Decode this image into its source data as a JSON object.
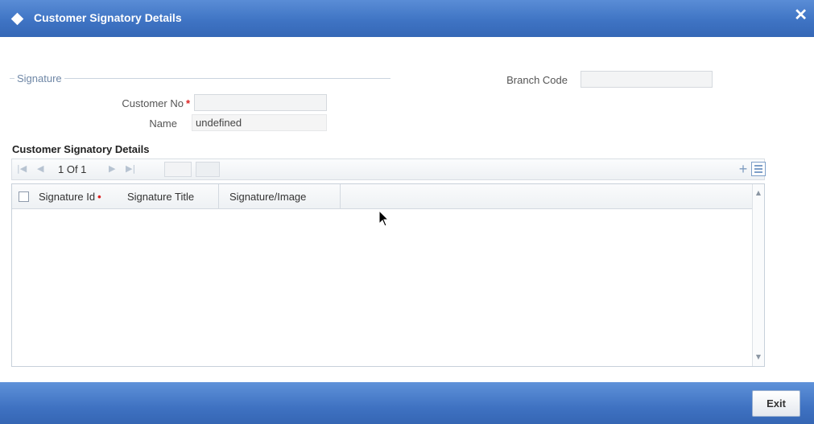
{
  "window": {
    "title": "Customer Signatory Details",
    "close_symbol": "✕",
    "colors": {
      "titlebar": "#3f74c4",
      "footer": "#3f72c2",
      "required": "#d22222"
    }
  },
  "signature_section": {
    "legend": "Signature",
    "customer_no_label": "Customer No",
    "customer_no_value": "",
    "name_label": "Name",
    "name_value": "undefined",
    "required_marker": "*"
  },
  "branch": {
    "label": "Branch Code",
    "value": ""
  },
  "signatory_grid": {
    "section_title": "Customer Signatory Details",
    "pager": {
      "current_page": 1,
      "total_pages": 1,
      "text": "1 Of 1",
      "page_input": "",
      "go_label": ""
    },
    "nav_icons": [
      "first-page-icon",
      "prev-page-icon",
      "next-page-icon",
      "last-page-icon"
    ],
    "toolbar_icons": [
      "add-row-icon",
      "single-view-icon"
    ],
    "columns": [
      {
        "label": "Signature Id",
        "required": true
      },
      {
        "label": "Signature Title",
        "required": false
      },
      {
        "label": "Signature/Image",
        "required": false
      }
    ],
    "rows": []
  },
  "footer": {
    "exit_label": "Exit"
  }
}
